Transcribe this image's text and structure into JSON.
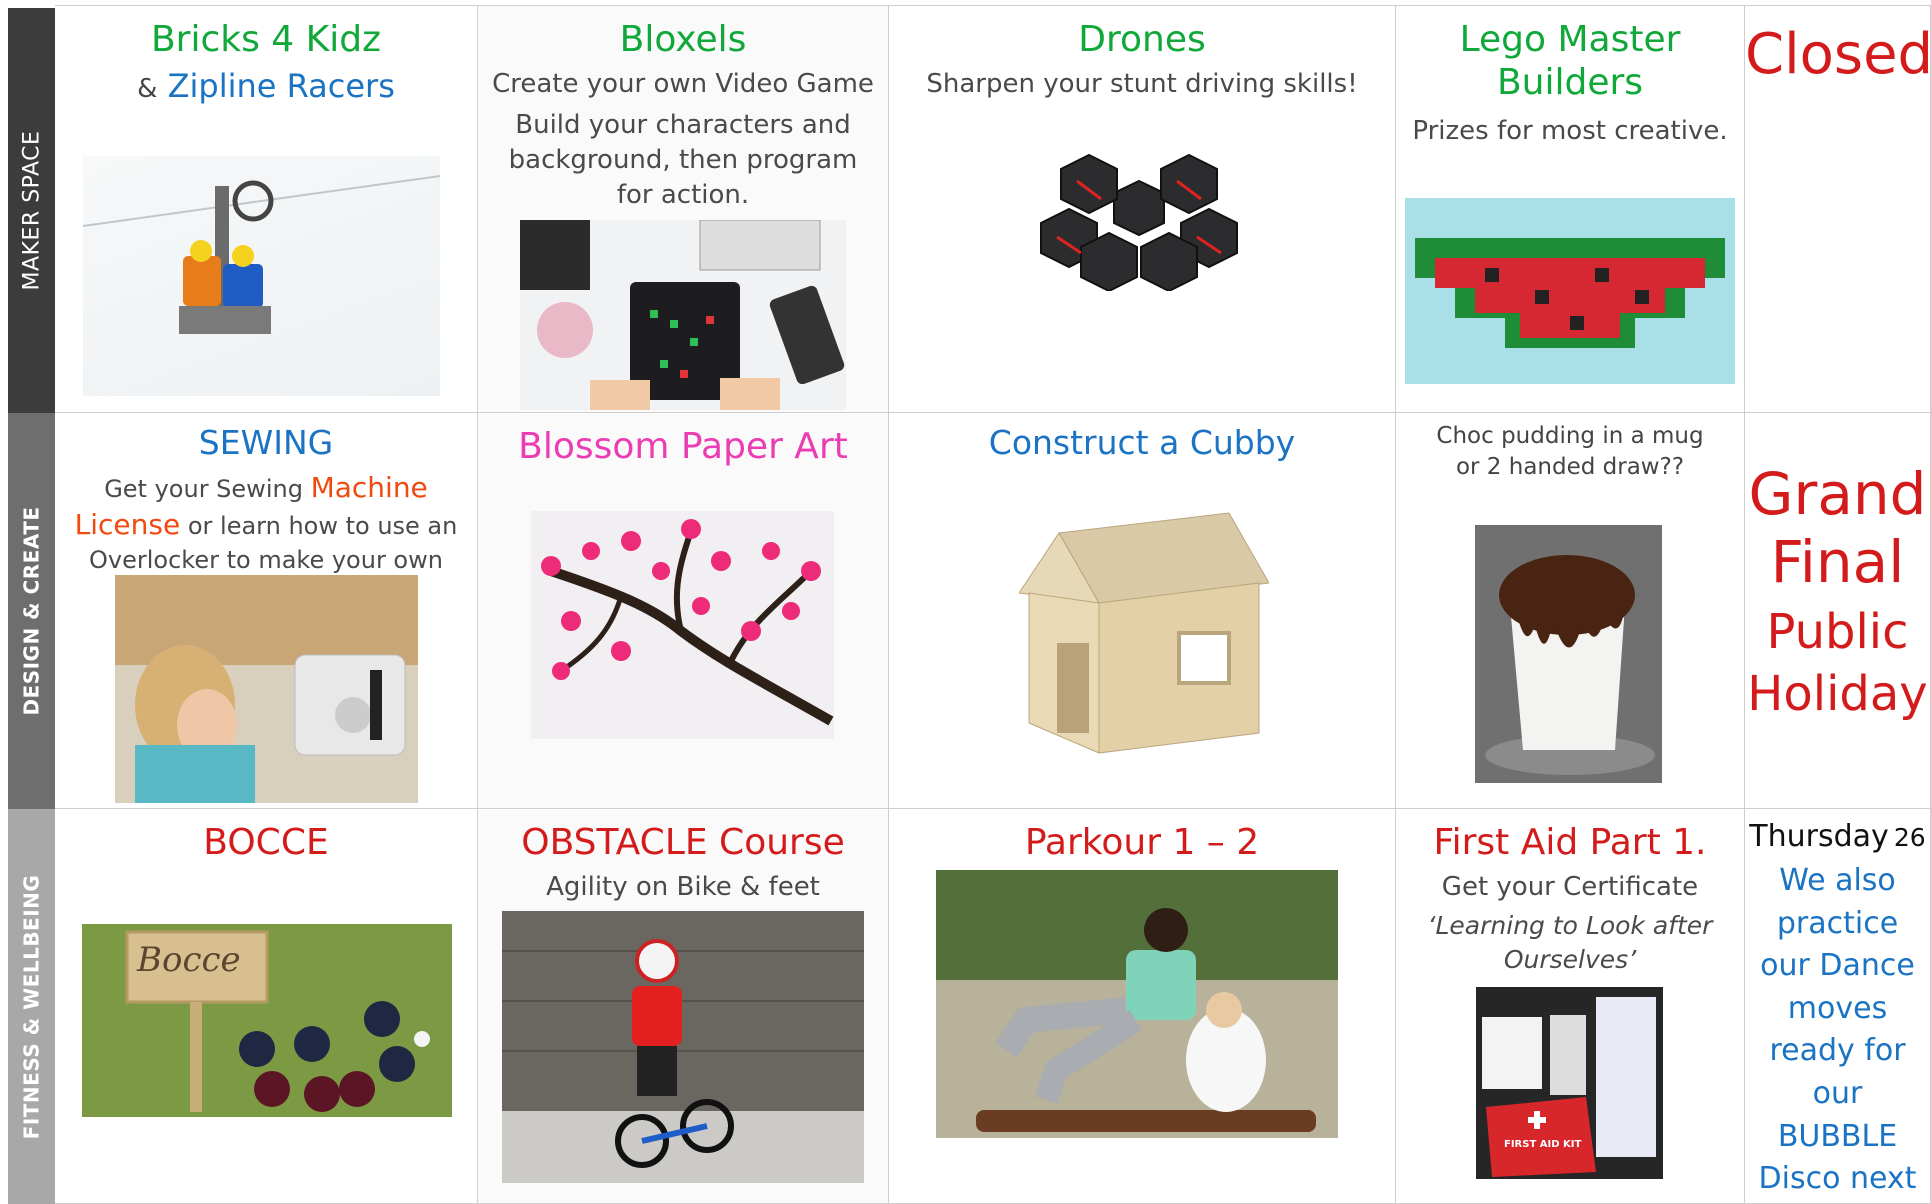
{
  "rows": [
    {
      "label": "MAKER SPACE"
    },
    {
      "label": "DESIGN & CREATE"
    },
    {
      "label": "FITNESS & WELLBEING"
    }
  ],
  "maker": {
    "bricks": {
      "title": "Bricks 4 Kidz",
      "amp": "&",
      "zipline": "Zipline Racers"
    },
    "bloxels": {
      "title": "Bloxels",
      "line1": "Create your own Video Game",
      "line2": "Build your characters and background, then program for action."
    },
    "drones": {
      "title": "Drones",
      "line1": "Sharpen your stunt driving skills!"
    },
    "lego": {
      "title": "Lego Master Builders",
      "line1": "Prizes for most creative."
    },
    "closed": "Closed"
  },
  "design": {
    "sewing": {
      "title": "SEWING",
      "pre": "Get your Sewing",
      "license": "Machine License",
      "rest": "or learn how to use an Overlocker to make your own BUFF"
    },
    "blossom": {
      "title": "Blossom Paper Art"
    },
    "cubby": {
      "title": "Construct a Cubby"
    },
    "choc": {
      "text": "Choc pudding in a mug or 2 handed draw??"
    },
    "grand": {
      "line1": "Grand",
      "line2": "Final",
      "line3": "Public",
      "line4": "Holiday"
    }
  },
  "fitness": {
    "bocce": {
      "title": "BOCCE",
      "sign": "Bocce"
    },
    "obstacle": {
      "title": "OBSTACLE Course",
      "line1": "Agility on Bike & feet"
    },
    "parkour": {
      "title": "Parkour 1 – 2"
    },
    "firstaid": {
      "title": "First Aid Part 1.",
      "line1": "Get your Certificate",
      "quote": "‘Learning to Look after Ourselves’",
      "kit": "FIRST AID KIT"
    },
    "thursday": {
      "day": "Thursday",
      "date": "26",
      "text": "We also practice our Dance moves ready for our BUBBLE Disco next week."
    }
  },
  "colors": {
    "green": "#11a83a",
    "blue": "#1b73c3",
    "red": "#d41b1b",
    "pink": "#ec3cb3",
    "orange": "#f04a10",
    "row1": "#3c3c3c",
    "row2": "#6e6e6e",
    "row3": "#a8a8a8"
  },
  "icons": [
    "zipline-lego-photo",
    "bloxels-board-photo",
    "drone-photo",
    "lego-watermelon-photo",
    "sewing-girl-photo",
    "blossom-art-photo",
    "cubby-house-photo",
    "mug-pudding-photo",
    "bocce-photo",
    "bike-boy-photo",
    "parkour-photo",
    "first-aid-kit-photo"
  ]
}
